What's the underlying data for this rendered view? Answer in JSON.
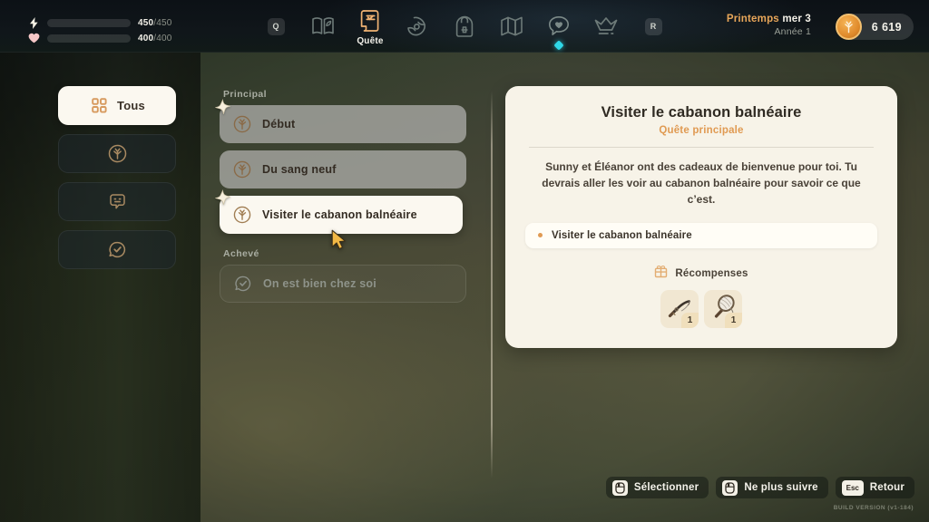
{
  "hud": {
    "energy": {
      "icon": "lightning-icon",
      "current": "450",
      "separator": "/",
      "max": "450",
      "fill_pct": 100,
      "color": "#5fe8cf"
    },
    "health": {
      "icon": "heart-icon",
      "current": "400",
      "separator": "/",
      "max": "400",
      "fill_pct": 100,
      "color": "#c7f392"
    },
    "date": {
      "season": "Printemps",
      "day": "mer 3",
      "year": "Année 1"
    },
    "currency": {
      "icon": "coin-icon",
      "amount": "6 619"
    }
  },
  "nav": {
    "left_key": "Q",
    "right_key": "R",
    "items": [
      {
        "icon": "journal-icon",
        "label": "",
        "active": false,
        "badge": false
      },
      {
        "icon": "quest-scroll-icon",
        "label": "Quête",
        "active": true,
        "badge": false
      },
      {
        "icon": "tools-icon",
        "label": "",
        "active": false,
        "badge": false
      },
      {
        "icon": "backpack-icon",
        "label": "",
        "active": false,
        "badge": false
      },
      {
        "icon": "map-icon",
        "label": "",
        "active": false,
        "badge": false
      },
      {
        "icon": "relationships-heart-icon",
        "label": "",
        "active": false,
        "badge": true
      },
      {
        "icon": "crown-icon",
        "label": "",
        "active": false,
        "badge": false
      }
    ]
  },
  "filters": [
    {
      "icon": "grid-icon",
      "label": "Tous",
      "active": true
    },
    {
      "icon": "main-quest-plant-icon",
      "label": "",
      "active": false
    },
    {
      "icon": "dialogue-bubble-icon",
      "label": "",
      "active": false
    },
    {
      "icon": "completed-check-bubble-icon",
      "label": "",
      "active": false
    }
  ],
  "quest_list": {
    "section_active_label": "Principal",
    "section_done_label": "Achevé",
    "active_quests": [
      {
        "icon": "main-quest-plant-icon",
        "title": "Début",
        "tracked": true,
        "selected": false
      },
      {
        "icon": "main-quest-plant-icon",
        "title": "Du sang neuf",
        "tracked": false,
        "selected": false
      },
      {
        "icon": "main-quest-plant-icon",
        "title": "Visiter le cabanon balnéaire",
        "tracked": true,
        "selected": true
      }
    ],
    "done_quests": [
      {
        "icon": "completed-check-bubble-icon",
        "title": "On est bien chez soi"
      }
    ]
  },
  "detail": {
    "title": "Visiter le cabanon balnéaire",
    "subtitle": "Quête principale",
    "description": "Sunny et Éléanor ont des cadeaux de bienvenue pour toi. Tu devrais aller les voir au cabanon balnéaire pour savoir ce que c’est.",
    "objective": "Visiter le cabanon balnéaire",
    "rewards_label": "Récompenses",
    "rewards_icon": "gift-box-icon",
    "rewards": [
      {
        "icon": "fishing-rod-icon",
        "qty": "1"
      },
      {
        "icon": "bug-net-icon",
        "qty": "1"
      }
    ]
  },
  "footer": {
    "buttons": [
      {
        "key": "⬜",
        "icon": "mouse-left-click-icon",
        "label": "Sélectionner"
      },
      {
        "key": "⬜",
        "icon": "mouse-left-click-icon",
        "label": "Ne plus suivre"
      },
      {
        "key": "Esc",
        "icon": "esc-key-icon",
        "label": "Retour"
      }
    ],
    "build_version": "BUILD VERSION  (v1-184)"
  },
  "cursor": {
    "icon": "pointer-arrow-cursor",
    "color": "#f2b845"
  },
  "colors": {
    "accent": "#e09a52",
    "panel": "#f7f3e8",
    "badge": "#2fd8e8"
  }
}
